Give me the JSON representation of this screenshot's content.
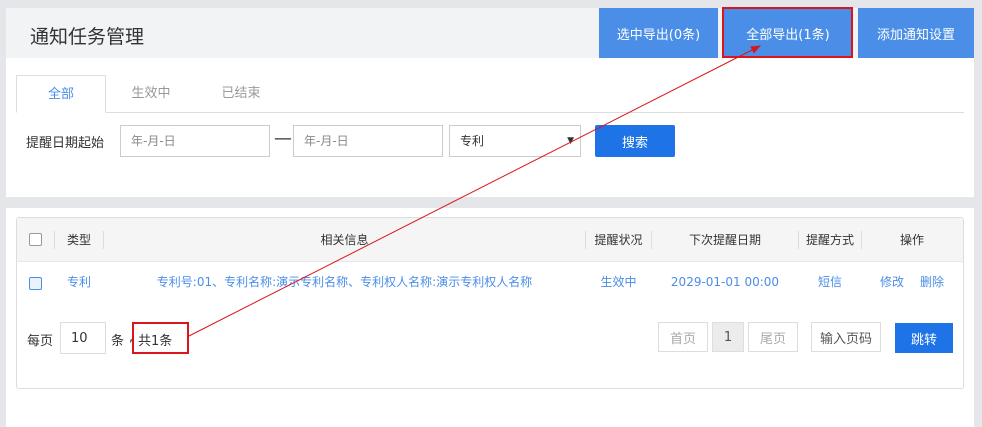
{
  "header": {
    "title": "通知任务管理",
    "export_selected": "选中导出(0条)",
    "export_all": "全部导出(1条)",
    "add_setting": "添加通知设置"
  },
  "tabs": [
    {
      "label": "全部",
      "active": true
    },
    {
      "label": "生效中",
      "active": false
    },
    {
      "label": "已结束",
      "active": false
    }
  ],
  "filter": {
    "label": "提醒日期起始",
    "start_placeholder": "年-月-日",
    "separator": "—",
    "end_placeholder": "年-月-日",
    "type_selected": "专利",
    "search_label": "搜索"
  },
  "table": {
    "columns": [
      "类型",
      "相关信息",
      "提醒状况",
      "下次提醒日期",
      "提醒方式",
      "操作"
    ],
    "rows": [
      {
        "type": "专利",
        "info": "专利号:01、专利名称:演示专利名称、专利权人名称:演示专利权人名称",
        "status": "生效中",
        "next_date": "2029-01-01 00:00",
        "method": "短信",
        "edit": "修改",
        "delete": "删除"
      }
    ]
  },
  "pagination": {
    "per_page_label": "每页",
    "per_page_value": "10",
    "unit": "条",
    "comma": ",",
    "total": "共1条",
    "first": "首页",
    "current": "1",
    "last": "尾页",
    "goto_placeholder": "输入页码",
    "goto_label": "跳转"
  },
  "colors": {
    "accent": "#4a8ee8",
    "primary_button": "#1e74e6",
    "annotation": "#d9161c"
  }
}
